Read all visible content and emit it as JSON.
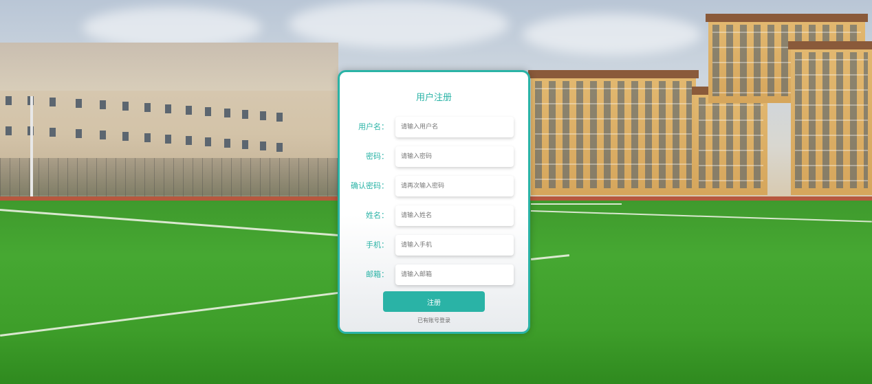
{
  "form": {
    "title": "用户注册",
    "fields": [
      {
        "label": "用户名：",
        "placeholder": "请输入用户名"
      },
      {
        "label": "密码：",
        "placeholder": "请输入密码"
      },
      {
        "label": "确认密码：",
        "placeholder": "请再次输入密码"
      },
      {
        "label": "姓名：",
        "placeholder": "请输入姓名"
      },
      {
        "label": "手机：",
        "placeholder": "请输入手机"
      },
      {
        "label": "邮箱：",
        "placeholder": "请输入邮箱"
      }
    ],
    "submit_label": "注册",
    "login_link": "已有账号登录"
  },
  "colors": {
    "accent": "#2ab3a6",
    "card_background": "#ffffff",
    "placeholder_text": "#777777"
  }
}
